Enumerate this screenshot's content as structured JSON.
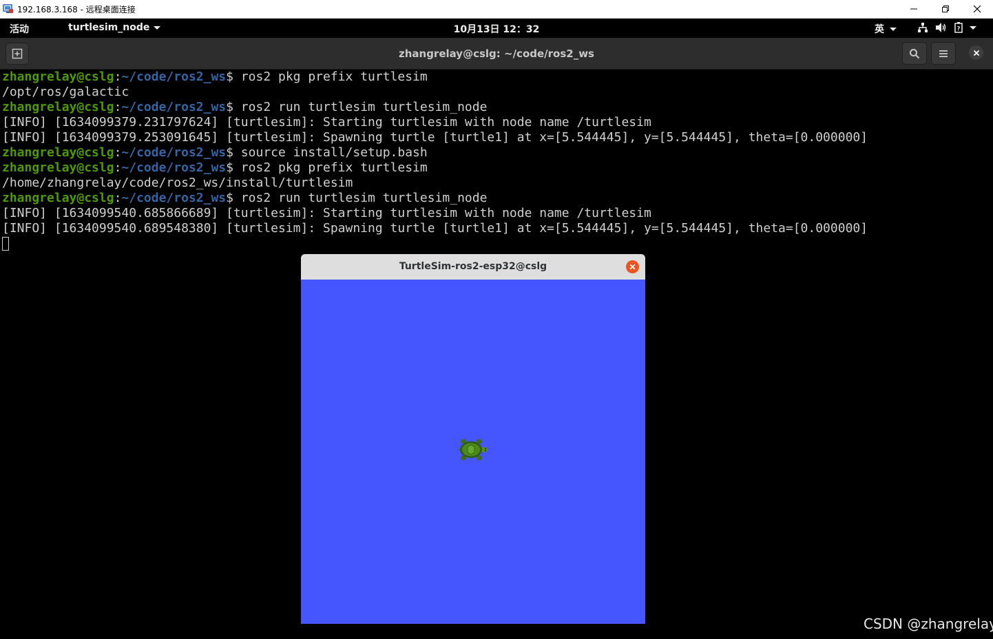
{
  "rdp_window": {
    "title": "192.168.3.168 - 远程桌面连接",
    "icon": "remote-desktop-icon"
  },
  "gnome_topbar": {
    "activities": "活动",
    "app_menu": "turtlesim_node",
    "clock": "10月13日  12：32",
    "input_method": "英",
    "tray_icons": [
      "network-icon",
      "volume-icon",
      "battery-icon",
      "system-menu-chevron-icon"
    ]
  },
  "terminal": {
    "title": "zhangrelay@cslg: ~/code/ros2_ws",
    "prompt_user": "zhangrelay@cslg",
    "prompt_path": "~/code/ros2_ws",
    "lines": [
      {
        "type": "prompt",
        "cmd": " ros2 pkg prefix turtlesim"
      },
      {
        "type": "output",
        "text": "/opt/ros/galactic"
      },
      {
        "type": "prompt",
        "cmd": " ros2 run turtlesim turtlesim_node"
      },
      {
        "type": "output",
        "text": "[INFO] [1634099379.231797624] [turtlesim]: Starting turtlesim with node name /turtlesim"
      },
      {
        "type": "output",
        "text": "[INFO] [1634099379.253091645] [turtlesim]: Spawning turtle [turtle1] at x=[5.544445], y=[5.544445], theta=[0.000000]"
      },
      {
        "type": "prompt",
        "cmd": " source install/setup.bash"
      },
      {
        "type": "prompt",
        "cmd": " ros2 pkg prefix turtlesim"
      },
      {
        "type": "output",
        "text": "/home/zhangrelay/code/ros2_ws/install/turtlesim"
      },
      {
        "type": "prompt",
        "cmd": " ros2 run turtlesim turtlesim_node"
      },
      {
        "type": "output",
        "text": "[INFO] [1634099540.685866689] [turtlesim]: Starting turtlesim with node name /turtlesim"
      },
      {
        "type": "output",
        "text": "[INFO] [1634099540.689548380] [turtlesim]: Spawning turtle [turtle1] at x=[5.544445], y=[5.544445], theta=[0.000000]"
      }
    ],
    "colors": {
      "user": "#4e9a06",
      "path": "#3465a4",
      "text": "#d0d0d0",
      "background": "#000000"
    }
  },
  "turtlesim_window": {
    "title": "TurtleSim-ros2-esp32@cslg",
    "background_color": "#4556ff",
    "turtle_name": "turtle1"
  },
  "watermark": "CSDN @zhangrelay"
}
